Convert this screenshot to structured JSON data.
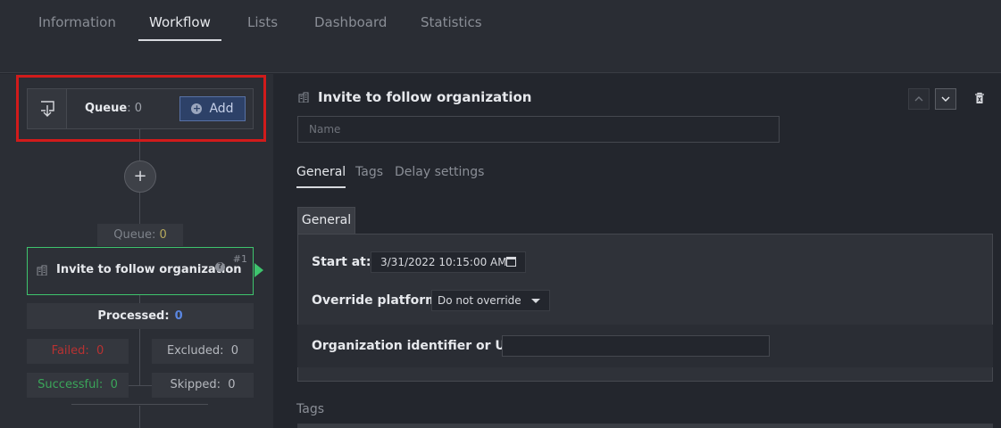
{
  "nav": {
    "tabs": [
      {
        "label": "Information",
        "active": false
      },
      {
        "label": "Workflow",
        "active": true
      },
      {
        "label": "Lists",
        "active": false
      },
      {
        "label": "Dashboard",
        "active": false
      },
      {
        "label": "Statistics",
        "active": false
      }
    ]
  },
  "workflow": {
    "queue_label": "Queue",
    "queue_count": ": 0",
    "add_label": "Add",
    "step_queue_label": "Queue:",
    "step_queue_count": "0",
    "step_title": "Invite to follow organization",
    "step_number": "#1",
    "processed_label": "Processed:",
    "processed_count": "0",
    "failed_label": "Failed:",
    "failed_count": "0",
    "excluded_label": "Excluded:",
    "excluded_count": "0",
    "successful_label": "Successful:",
    "successful_count": "0",
    "skipped_label": "Skipped:",
    "skipped_count": "0"
  },
  "detail": {
    "title": "Invite to follow organization",
    "name_placeholder": "Name",
    "tabs": [
      {
        "label": "General",
        "active": true
      },
      {
        "label": "Tags",
        "active": false
      },
      {
        "label": "Delay settings",
        "active": false
      }
    ],
    "section_tab": "General",
    "start_label": "Start at:",
    "start_value": "3/31/2022 10:15:00 AM",
    "override_label": "Override platform:",
    "override_value": "Do not override",
    "org_label": "Organization identifier or URL:",
    "tags_label": "Tags"
  },
  "colors": {
    "background": "#23262d",
    "highlight": "#d11b1b",
    "success": "#3ec46d",
    "failed": "#b83232",
    "accent": "#5a86e0"
  }
}
